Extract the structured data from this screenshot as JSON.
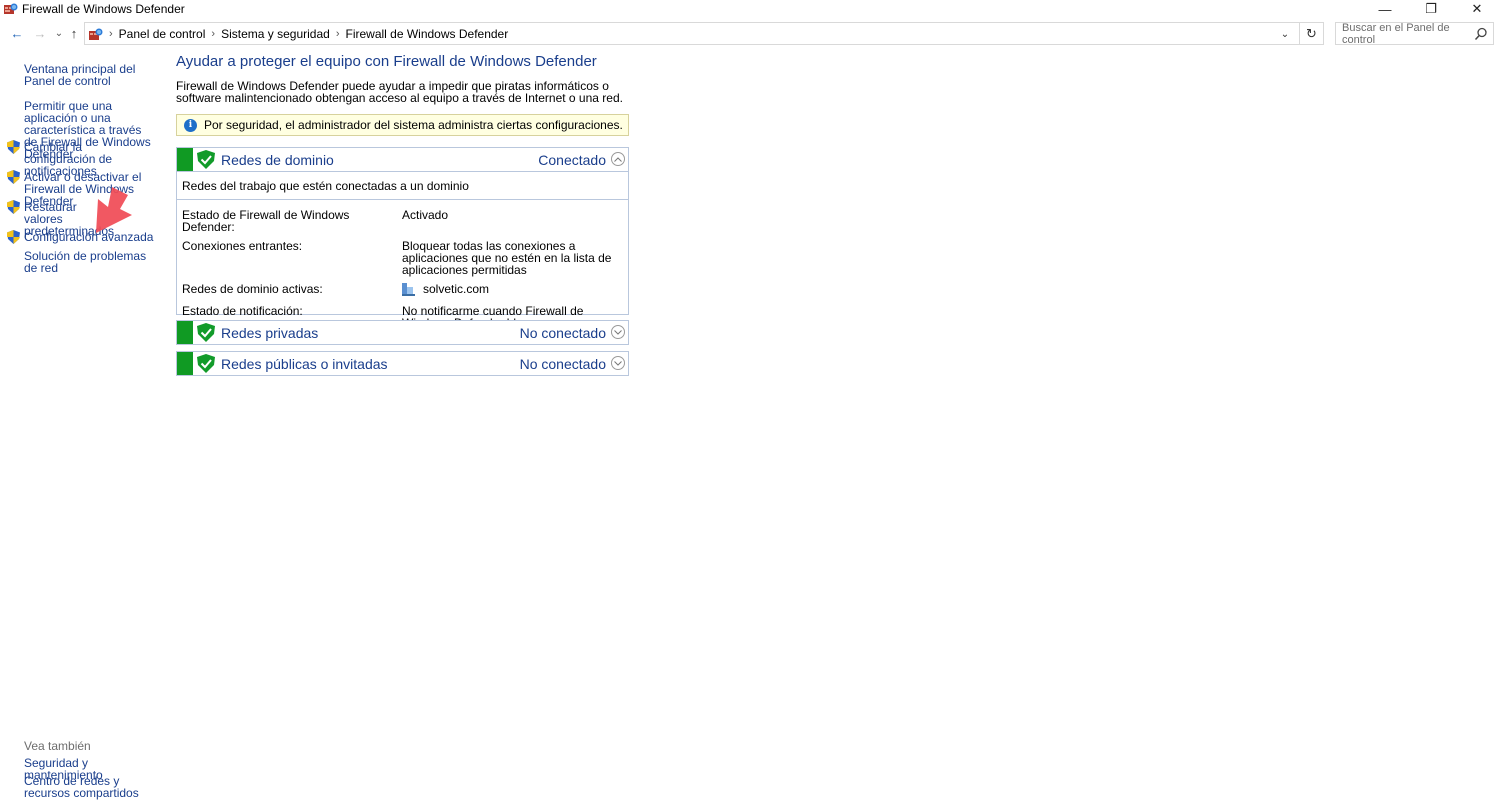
{
  "window": {
    "title": "Firewall de Windows Defender",
    "controls": {
      "minimize": "—",
      "restore": "❐",
      "close": "✕"
    }
  },
  "nav": {
    "back": "←",
    "forward": "→",
    "recent": "⌄",
    "up": "↑",
    "breadcrumb": [
      "Panel de control",
      "Sistema y seguridad",
      "Firewall de Windows Defender"
    ],
    "separator": "›",
    "dropdown": "⌄",
    "refresh": "↻",
    "search_placeholder": "Buscar en el Panel de control"
  },
  "sidebar": {
    "links": [
      {
        "label": "Ventana principal del Panel de control",
        "shield": false
      },
      {
        "label": "Permitir que una aplicación o una característica a través de Firewall de Windows Defender",
        "shield": false
      },
      {
        "label": "Cambiar la configuración de notificaciones",
        "shield": true
      },
      {
        "label": "Activar o desactivar el Firewall de Windows Defender",
        "shield": true
      },
      {
        "label": "Restaurar valores predeterminados",
        "shield": true
      },
      {
        "label": "Configuración avanzada",
        "shield": true
      },
      {
        "label": "Solución de problemas de red",
        "shield": false
      }
    ],
    "see_also": {
      "label": "Vea también",
      "links": [
        "Seguridad y mantenimiento",
        "Centro de redes y recursos compartidos"
      ]
    }
  },
  "main": {
    "title": "Ayudar a proteger el equipo con Firewall de Windows Defender",
    "description": "Firewall de Windows Defender puede ayudar a impedir que piratas informáticos o software malintencionado obtengan acceso al equipo a través de Internet o una red.",
    "info_icon": "i",
    "info_message": "Por seguridad, el administrador del sistema administra ciertas configuraciones.",
    "networks": [
      {
        "title": "Redes de dominio",
        "status": "Conectado",
        "expanded": true,
        "subtitle": "Redes del trabajo que estén conectadas a un dominio",
        "details": [
          {
            "label": "Estado de Firewall de Windows Defender:",
            "value": "Activado"
          },
          {
            "label": "Conexiones entrantes:",
            "value": "Bloquear todas las conexiones a aplicaciones que no estén en la lista de aplicaciones permitidas"
          },
          {
            "label": "Redes de dominio activas:",
            "value": "solvetic.com"
          },
          {
            "label": "Estado de notificación:",
            "value": "No notificarme cuando Firewall de Windows Defender bloquee una nueva aplicación"
          }
        ]
      },
      {
        "title": "Redes privadas",
        "status": "No conectado",
        "expanded": false
      },
      {
        "title": "Redes públicas o invitadas",
        "status": "No conectado",
        "expanded": false
      }
    ]
  },
  "colors": {
    "link": "#1a3e8c",
    "accent_green": "#109a23",
    "info_bg": "#ffffe1",
    "border": "#b9c7dd",
    "annotation_arrow": "#f04a55"
  }
}
